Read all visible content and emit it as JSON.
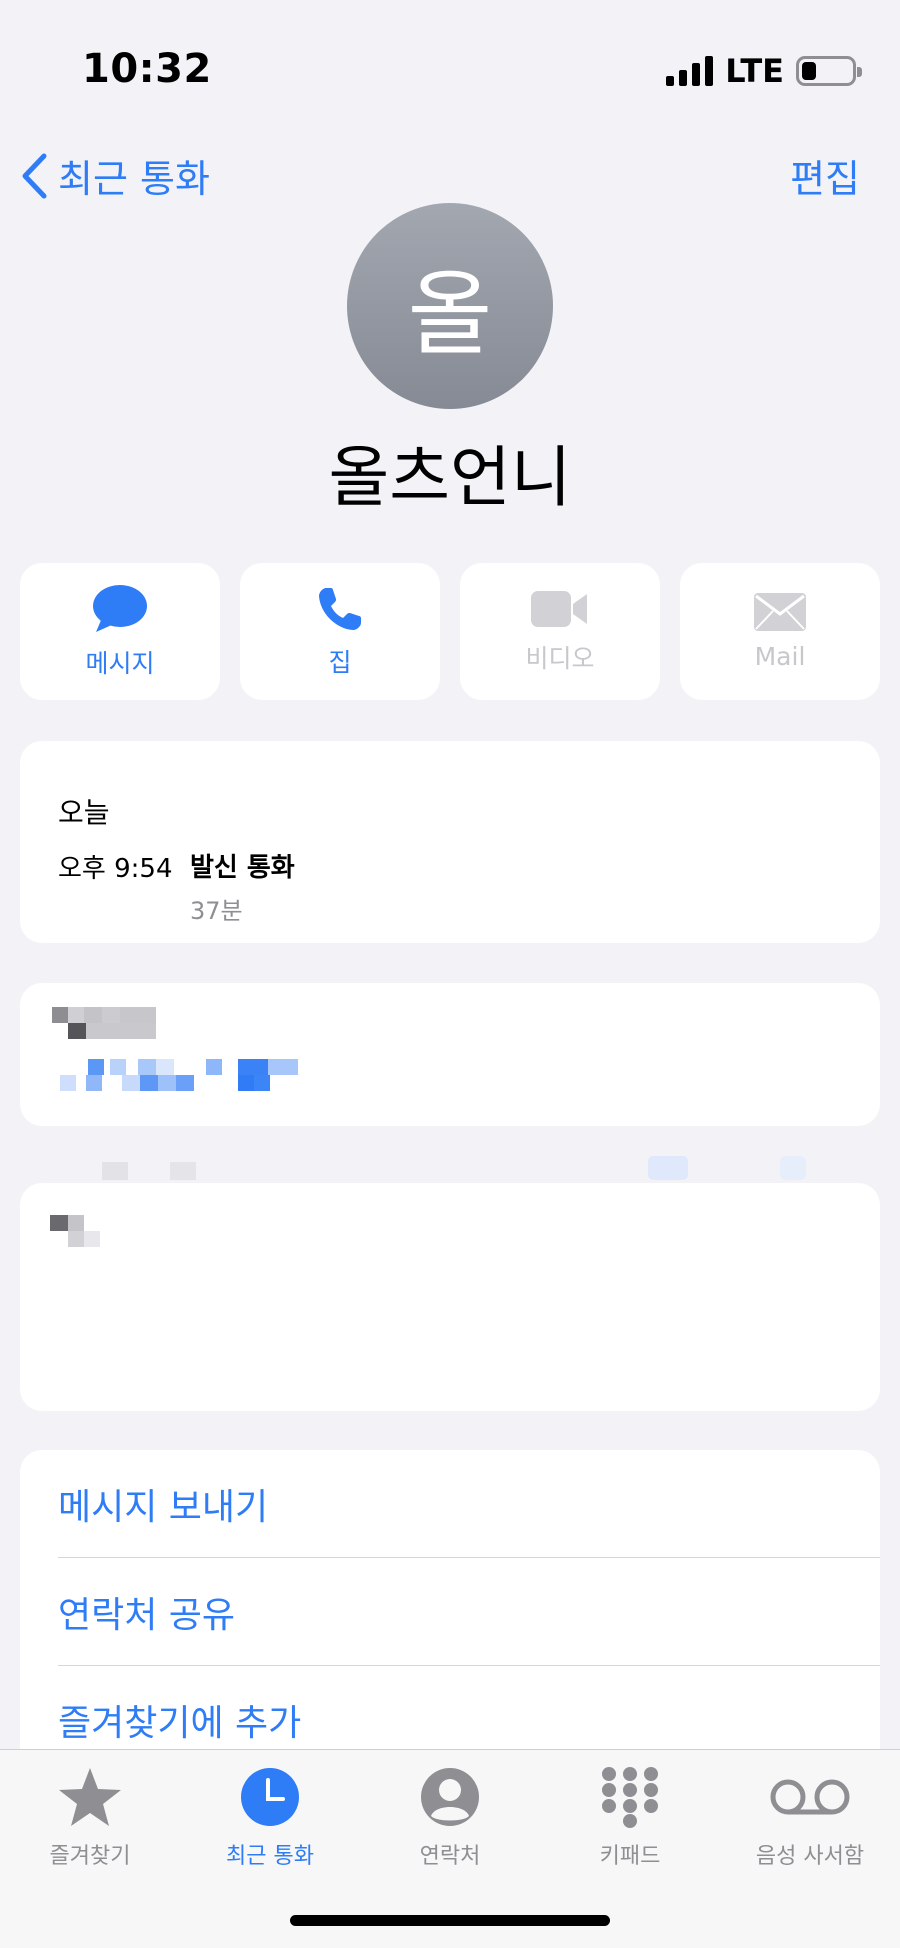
{
  "status_bar": {
    "time": "10:32",
    "network": "LTE"
  },
  "nav": {
    "back_label": "최근 통화",
    "edit_label": "편집"
  },
  "contact": {
    "avatar_initial": "올",
    "name": "올츠언니"
  },
  "actions": [
    {
      "label": "메시지",
      "icon": "message-bubble-icon",
      "enabled": true
    },
    {
      "label": "집",
      "icon": "phone-icon",
      "enabled": true
    },
    {
      "label": "비디오",
      "icon": "video-camera-icon",
      "enabled": false
    },
    {
      "label": "Mail",
      "icon": "envelope-icon",
      "enabled": false
    }
  ],
  "call_history": {
    "day": "오늘",
    "time": "오후 9:54",
    "type": "발신 통화",
    "duration": "37분"
  },
  "menu_links": [
    "메시지 보내기",
    "연락처 공유",
    "즐겨찾기에 추가"
  ],
  "tab_bar": {
    "tabs": [
      {
        "label": "즐겨찾기",
        "icon": "star-icon",
        "active": false
      },
      {
        "label": "최근 통화",
        "icon": "clock-icon",
        "active": true
      },
      {
        "label": "연락처",
        "icon": "person-circle-icon",
        "active": false
      },
      {
        "label": "키패드",
        "icon": "keypad-icon",
        "active": false
      },
      {
        "label": "음성 사서함",
        "icon": "voicemail-icon",
        "active": false
      }
    ]
  },
  "colors": {
    "accent": "#2e7cf6",
    "background": "#f2f2f7",
    "disabled": "#c7c7cc",
    "inactive_tab": "#8e8e93"
  }
}
